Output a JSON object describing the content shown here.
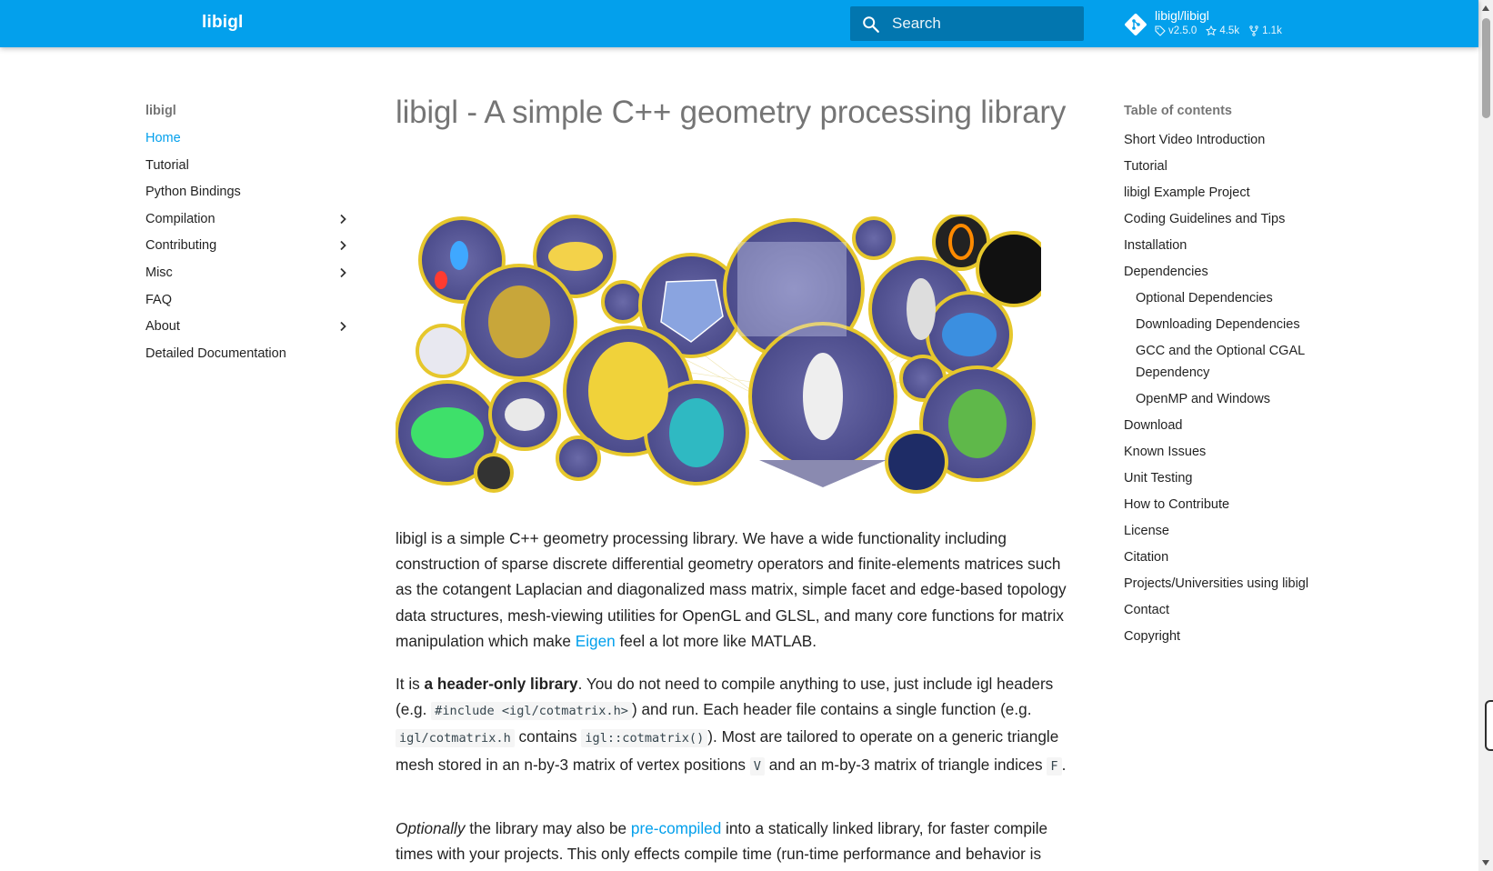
{
  "header": {
    "brand": "libigl",
    "search_placeholder": "Search",
    "repo": {
      "name": "libigl/libigl",
      "version": "v2.5.0",
      "stars": "4.5k",
      "forks": "1.1k"
    },
    "color": "#03a0ec"
  },
  "nav": {
    "title": "libigl",
    "items": [
      {
        "label": "Home",
        "active": true,
        "expandable": false
      },
      {
        "label": "Tutorial",
        "expandable": false
      },
      {
        "label": "Python Bindings",
        "expandable": false
      },
      {
        "label": "Compilation",
        "expandable": true
      },
      {
        "label": "Contributing",
        "expandable": true
      },
      {
        "label": "Misc",
        "expandable": true
      },
      {
        "label": "FAQ",
        "expandable": false
      },
      {
        "label": "About",
        "expandable": true
      },
      {
        "label": "Detailed Documentation",
        "expandable": false
      }
    ]
  },
  "main": {
    "title": "libigl - A simple C++ geometry processing library",
    "p1": {
      "text": "libigl is a simple C++ geometry processing library. We have a wide functionality including construction of sparse discrete differential geometry operators and finite-elements matrices such as the cotangent Laplacian and diagonalized mass matrix, simple facet and edge-based topology data structures, mesh-viewing utilities for OpenGL and GLSL, and many core functions for matrix manipulation which make ",
      "link": "Eigen",
      "tail": " feel a lot more like MATLAB."
    },
    "p2": {
      "a": "It is ",
      "bold": "a header-only library",
      "b": ". You do not need to compile anything to use, just include igl headers (e.g. ",
      "code1": "#include <igl/cotmatrix.h>",
      "c": ") and run. Each header file contains a single function (e.g. ",
      "code2": "igl/cotmatrix.h",
      "d": " contains ",
      "code3": "igl::cotmatrix()",
      "e": "). Most are tailored to operate on a generic triangle mesh stored in an n-by-3 matrix of vertex positions ",
      "code4": "V",
      "f": " and an m-by-3 matrix of triangle indices ",
      "code5": "F",
      "g": "."
    },
    "p3": {
      "italic": "Optionally",
      "a": " the library may also be ",
      "link": "pre-compiled",
      "b": " into a statically linked library, for faster compile times with your projects. This only effects compile time (run-time performance and behavior is"
    }
  },
  "toc": {
    "title": "Table of contents",
    "items": [
      {
        "label": "Short Video Introduction",
        "level": 1
      },
      {
        "label": "Tutorial",
        "level": 1
      },
      {
        "label": "libigl Example Project",
        "level": 1
      },
      {
        "label": "Coding Guidelines and Tips",
        "level": 1
      },
      {
        "label": "Installation",
        "level": 1
      },
      {
        "label": "Dependencies",
        "level": 1
      },
      {
        "label": "Optional Dependencies",
        "level": 2
      },
      {
        "label": "Downloading Dependencies",
        "level": 2
      },
      {
        "label": "GCC and the Optional CGAL Dependency",
        "level": 2
      },
      {
        "label": "OpenMP and Windows",
        "level": 2
      },
      {
        "label": "Download",
        "level": 1
      },
      {
        "label": "Known Issues",
        "level": 1
      },
      {
        "label": "Unit Testing",
        "level": 1
      },
      {
        "label": "How to Contribute",
        "level": 1
      },
      {
        "label": "License",
        "level": 1
      },
      {
        "label": "Citation",
        "level": 1
      },
      {
        "label": "Projects/Universities using libigl",
        "level": 1
      },
      {
        "label": "Contact",
        "level": 1
      },
      {
        "label": "Copyright",
        "level": 1
      }
    ]
  }
}
